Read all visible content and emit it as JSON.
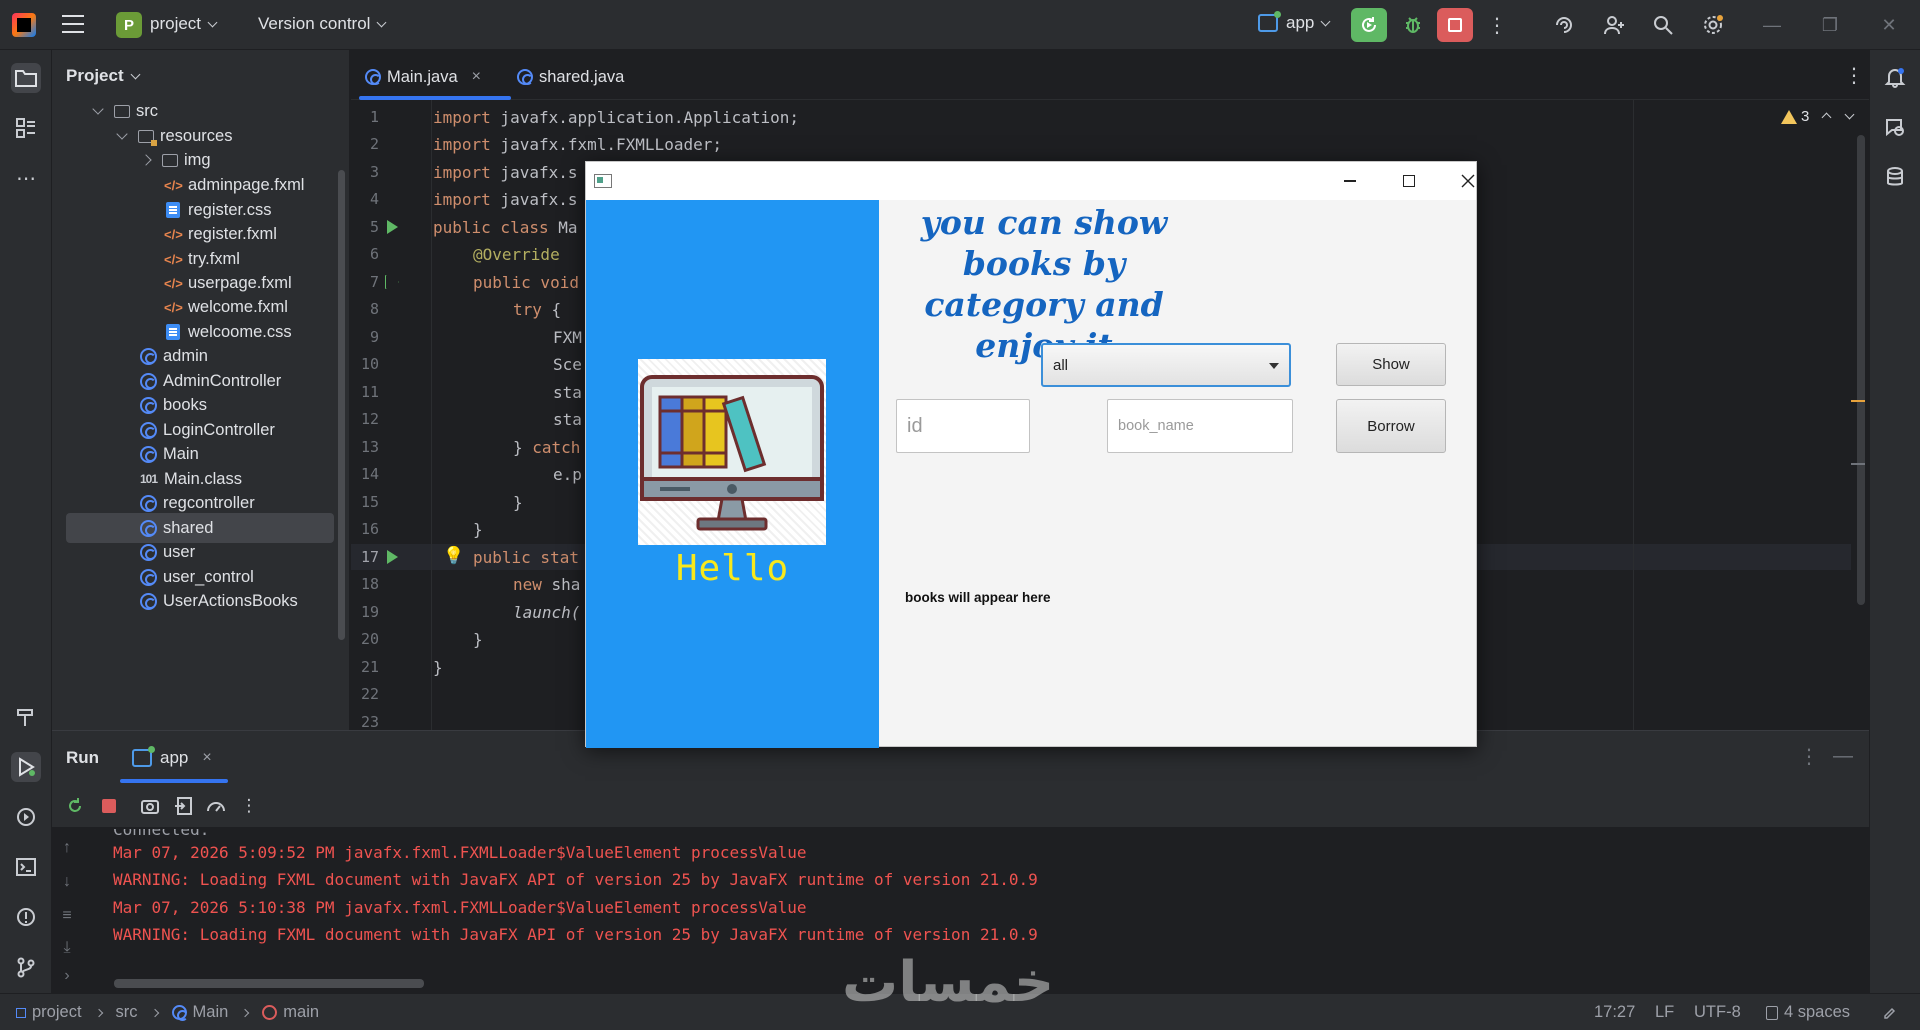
{
  "titlebar": {
    "project_badge": "P",
    "project_name": "project",
    "version_control": "Version control",
    "run_config": "app"
  },
  "project_panel": {
    "title": "Project",
    "items": [
      {
        "label": "src",
        "type": "folder"
      },
      {
        "label": "resources",
        "type": "resfolder"
      },
      {
        "label": "img",
        "type": "folder"
      },
      {
        "label": "adminpage.fxml",
        "type": "fxml"
      },
      {
        "label": "register.css",
        "type": "css"
      },
      {
        "label": "register.fxml",
        "type": "fxml"
      },
      {
        "label": "try.fxml",
        "type": "fxml"
      },
      {
        "label": "userpage.fxml",
        "type": "fxml"
      },
      {
        "label": "welcome.fxml",
        "type": "fxml"
      },
      {
        "label": "welcoome.css",
        "type": "css"
      },
      {
        "label": "admin",
        "type": "class"
      },
      {
        "label": "AdminController",
        "type": "class"
      },
      {
        "label": "books",
        "type": "class"
      },
      {
        "label": "LoginController",
        "type": "class"
      },
      {
        "label": "Main",
        "type": "class"
      },
      {
        "label": "Main.class",
        "type": "binary"
      },
      {
        "label": "regcontroller",
        "type": "class"
      },
      {
        "label": "shared",
        "type": "class"
      },
      {
        "label": "user",
        "type": "class"
      },
      {
        "label": "user_control",
        "type": "class"
      },
      {
        "label": "UserActionsBooks",
        "type": "class"
      }
    ]
  },
  "editor": {
    "tabs": [
      {
        "label": "Main.java",
        "close": "×"
      },
      {
        "label": "shared.java"
      }
    ],
    "warnings_count": "3",
    "line_numbers": [
      "1",
      "2",
      "3",
      "4",
      "5",
      "6",
      "7",
      "8",
      "9",
      "10",
      "11",
      "12",
      "13",
      "14",
      "15",
      "16",
      "17",
      "18",
      "19",
      "20",
      "21",
      "22",
      "23"
    ],
    "code": {
      "l1_kw": "import",
      "l1": " javafx.application.Application;",
      "l2_kw": "import",
      "l2": " javafx.fxml.FXMLLoader;",
      "l3_kw": "import",
      "l3": " javafx.s",
      "l4_kw": "import",
      "l4": " javafx.s",
      "l5_kw": "public class",
      "l5": " Ma",
      "l6": "@Override",
      "l7_kw": "public void",
      "l8_kw": "try",
      "l8": " {",
      "l9": "FXM",
      "l10": "Sce",
      "l11": "sta",
      "l12": "sta",
      "l13_a": "} ",
      "l13_kw": "catch",
      "l14": "e.p",
      "l15": "}",
      "l16": "}",
      "l17_kw": "public stat",
      "l18_kw": "new",
      "l18": " sha",
      "l19": "launch(",
      "l20": "}",
      "l21": "}"
    }
  },
  "run_panel": {
    "title": "Run",
    "tab": "app",
    "tab_close": "×",
    "lines": [
      "Mar 07, 2026 5:09:52 PM javafx.fxml.FXMLLoader$ValueElement processValue",
      "WARNING: Loading FXML document with JavaFX API of version 25 by JavaFX runtime of version 21.0.9",
      "Mar 07, 2026 5:10:38 PM javafx.fxml.FXMLLoader$ValueElement processValue",
      "WARNING: Loading FXML document with JavaFX API of version 25 by JavaFX runtime of version 21.0.9"
    ],
    "partial_top_line": "Connected."
  },
  "status_bar": {
    "breadcrumb": [
      "project",
      "src",
      "Main",
      "main"
    ],
    "position": "17:27",
    "line_sep": "LF",
    "encoding": "UTF-8",
    "indent": "4 spaces"
  },
  "fx_window": {
    "hello": "Hello",
    "heading": "you can show books by category and enjoy it",
    "combo_value": "all",
    "show_button": "Show",
    "borrow_button": "Borrow",
    "id_placeholder": "id",
    "book_name_placeholder": "book_name",
    "info_label": "books will appear here"
  },
  "watermark": "خمسات",
  "colors": {
    "accent": "#3574f0",
    "run_green": "#5fb865",
    "stop_red": "#db5c5c",
    "fx_blue_panel": "#2196f3",
    "fx_heading": "#1565c0",
    "console_error": "#ef5350"
  }
}
